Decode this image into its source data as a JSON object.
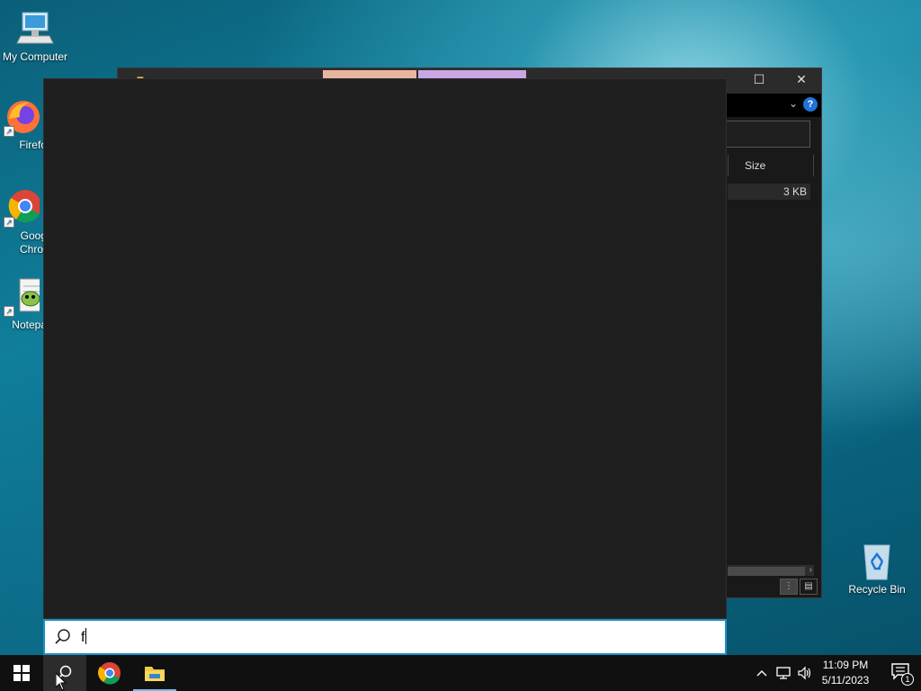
{
  "desktop": {
    "icons": [
      {
        "label": "My Computer",
        "icon": "computer-icon"
      },
      {
        "label": "Firefo",
        "icon": "firefox-icon"
      },
      {
        "label": "Goog\nChror",
        "icon": "chrome-icon"
      },
      {
        "label": "Notepa",
        "icon": "notepad-plus-plus-icon"
      },
      {
        "label": "Recycle Bin",
        "icon": "recycle-bin-icon"
      }
    ]
  },
  "explorer": {
    "column_header": "Size",
    "row_size": "3 KB",
    "help": "?"
  },
  "search": {
    "query": "f"
  },
  "taskbar": {
    "clock_time": "11:09 PM",
    "clock_date": "5/11/2023",
    "notification_count": "1"
  },
  "colors": {
    "accent": "#1e90c8",
    "taskbar_bg": "#101010",
    "search_panel_bg": "#1f1f1f"
  }
}
